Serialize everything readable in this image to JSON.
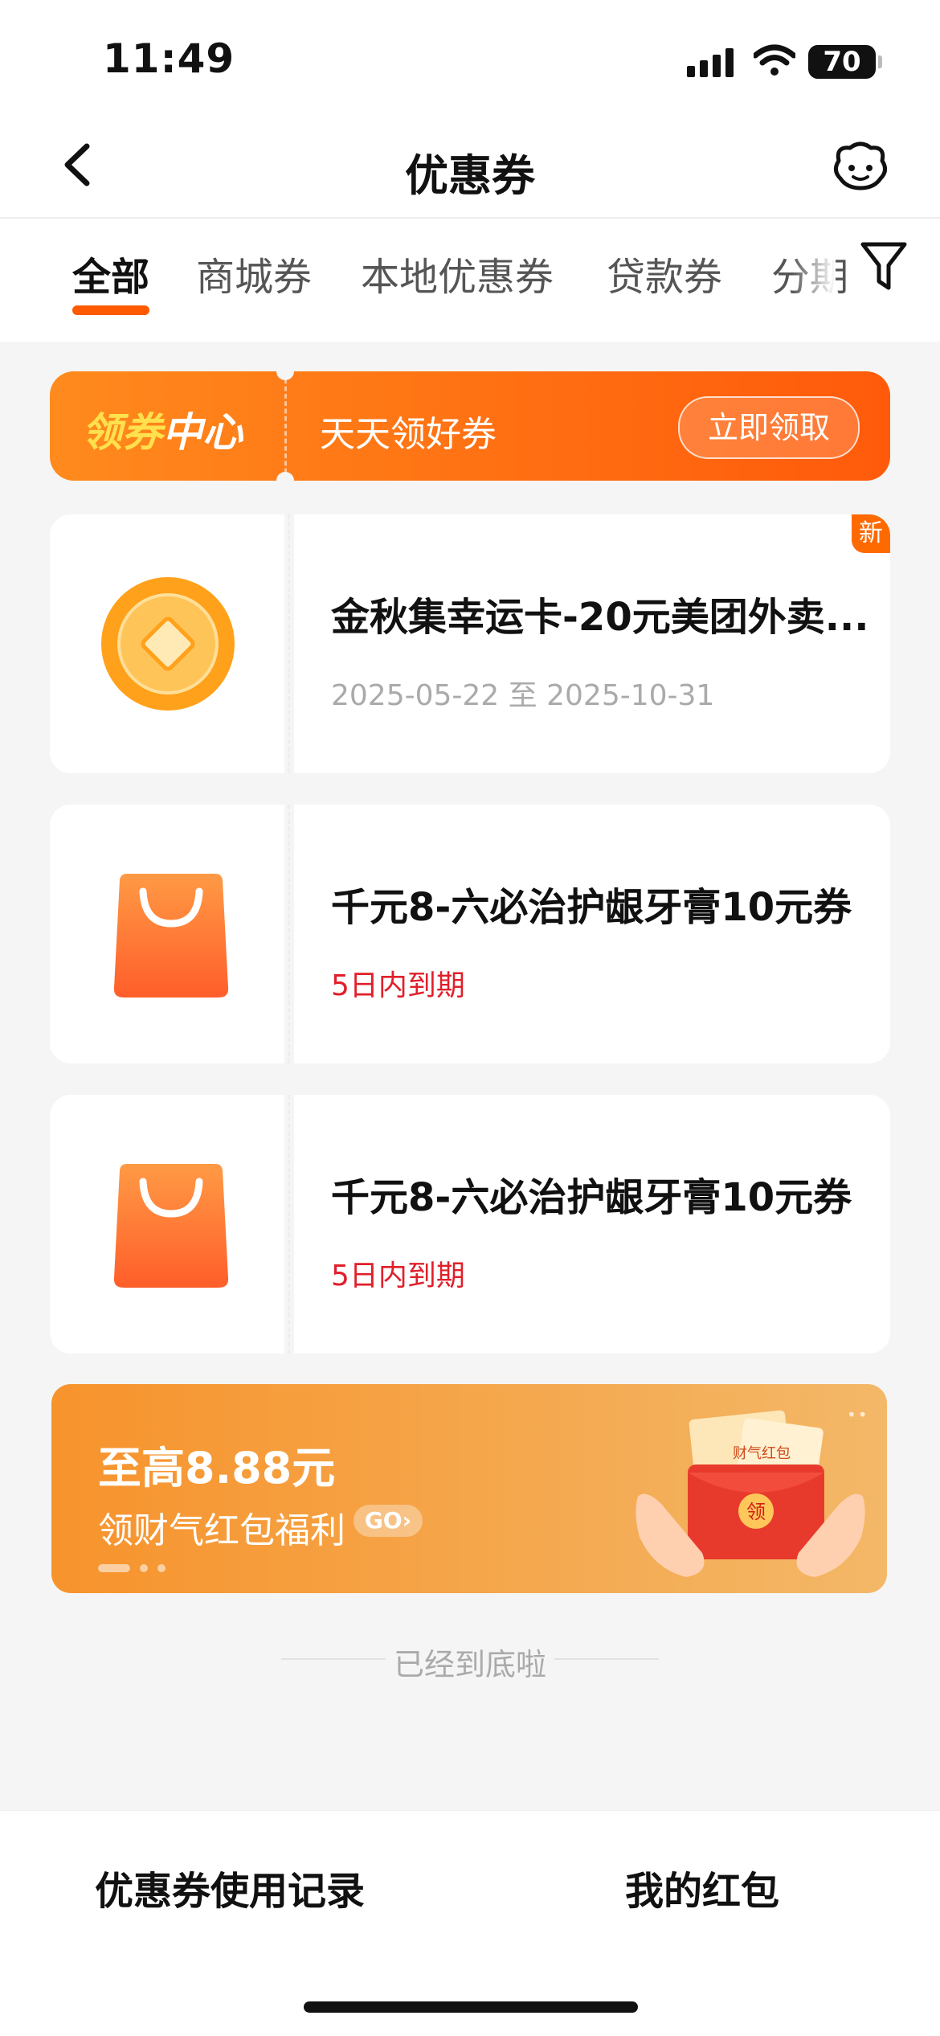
{
  "status_bar": {
    "time": "11:49",
    "battery": "70"
  },
  "header": {
    "title": "优惠券"
  },
  "tabs": [
    {
      "label": "全部",
      "active": true
    },
    {
      "label": "商城券"
    },
    {
      "label": "本地优惠券"
    },
    {
      "label": "贷款券"
    },
    {
      "label": "分期"
    }
  ],
  "banner": {
    "title_part1": "领券",
    "title_part2": "中心",
    "subtitle": "天天领好券",
    "button": "立即领取"
  },
  "coupons": [
    {
      "title": "金秋集幸运卡-20元美团外卖...",
      "sub": "2025-05-22 至 2025-10-31",
      "badge": "新",
      "icon": "gold-coin-icon"
    },
    {
      "title": "千元8-六必治护龈牙膏10元券",
      "sub": "5日内到期",
      "icon": "shopping-bag-icon"
    },
    {
      "title": "千元8-六必治护龈牙膏10元券",
      "sub": "5日内到期",
      "icon": "shopping-bag-icon"
    }
  ],
  "promo": {
    "title": "至高8.88元",
    "subtitle": "领财气红包福利",
    "go": "GO›",
    "envelope_text": "财气红包",
    "envelope_seal": "领"
  },
  "end_text": "已经到底啦",
  "bottom_bar": {
    "left": "优惠券使用记录",
    "right": "我的红包"
  },
  "colors": {
    "accent": "#ff5a00",
    "expiry_red": "#e0202b"
  }
}
